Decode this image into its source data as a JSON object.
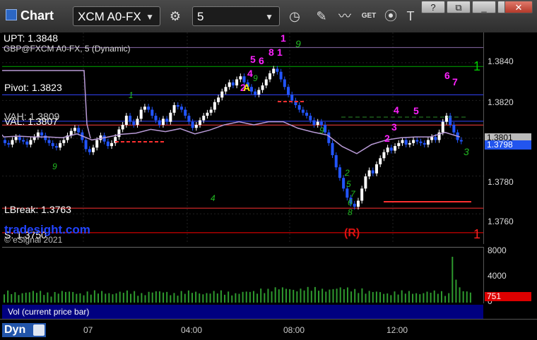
{
  "window": {
    "title": "Chart"
  },
  "toolbar": {
    "symbol": "XCM A0-FX",
    "interval": "5",
    "buttons": [
      "settings",
      "time-template",
      "draw",
      "study",
      "get",
      "cursor",
      "text"
    ],
    "get_label": "GET"
  },
  "window_controls": {
    "help": "?",
    "restore": "⧉",
    "minimize": "_",
    "maximize": "□",
    "close": "✕"
  },
  "chart": {
    "study_title": "GBP@FXCM A0-FX, 5 (Dynamic)",
    "watermark_site": "tradesight.com",
    "watermark_copyright": "© eSignal 2021",
    "levels": [
      {
        "name": "UPT",
        "text": "UPT: 1.3848",
        "value": 1.3848,
        "color": "#8a6aa8"
      },
      {
        "name": "R1",
        "text": "1",
        "value": 1.3838,
        "color": "#00aa00"
      },
      {
        "name": "Pivot",
        "text": "Pivot: 1.3823",
        "value": 1.3823,
        "color": "#3344ff"
      },
      {
        "name": "VAH",
        "text": "VAH: 1.3809",
        "value": 1.3809,
        "color": "#3344ff"
      },
      {
        "name": "VAL",
        "text": "VAL: 1.3807",
        "value": 1.3807,
        "color": "#ff4040"
      },
      {
        "name": "LBreak",
        "text": "LBreak: 1.3763",
        "value": 1.3763,
        "color": "#ff3030"
      },
      {
        "name": "S",
        "text": "S: 1.3750",
        "value": 1.375,
        "color": "#ff0000"
      }
    ],
    "price_axis": [
      "1.3840",
      "1.3820",
      "1.3801",
      "1.3798",
      "1.3780",
      "1.3760"
    ],
    "last_price": "1.3798",
    "prev_price": "1.3801",
    "markers": {
      "magenta": [
        "1",
        "5",
        "6",
        "8",
        "1",
        "4",
        "2",
        "6",
        "7",
        "4",
        "5",
        "3",
        "2"
      ],
      "yellow": [
        "A"
      ],
      "green_right": "3",
      "reversal": "(R)",
      "s_marker": "1",
      "top_green": "9",
      "green_count": [
        "1",
        "4",
        "9",
        "8",
        "7",
        "2",
        "5",
        "6",
        "9",
        "9"
      ]
    }
  },
  "volume": {
    "label": "Vol (current price bar)",
    "axis": [
      "8000",
      "4000",
      "0"
    ],
    "current": "751"
  },
  "time_axis": {
    "labels": [
      "07",
      "04:00",
      "08:00",
      "12:00"
    ],
    "dyn_label": "Dyn"
  },
  "colors": {
    "up_candle": "#ffffff",
    "down_candle": "#2255ff",
    "vwap": "#b89ad6",
    "volume": "#2e9a2e"
  }
}
